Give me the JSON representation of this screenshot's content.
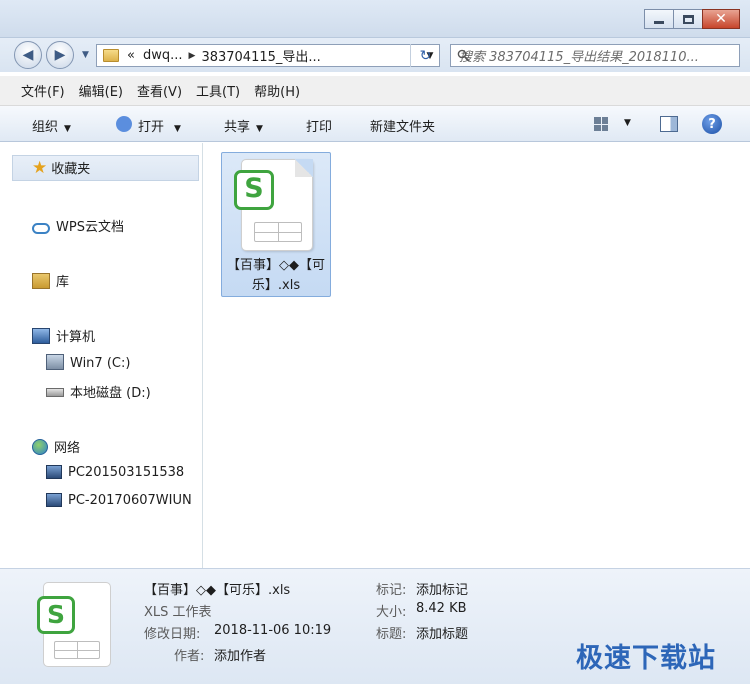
{
  "address": {
    "crumb_prefix": "«",
    "crumbs": [
      "dwq...",
      "383704115_导出..."
    ],
    "search_placeholder": "搜索 383704115_导出结果_2018110..."
  },
  "menu": [
    "文件(F)",
    "编辑(E)",
    "查看(V)",
    "工具(T)",
    "帮助(H)"
  ],
  "toolbar": {
    "organize": "组织",
    "open": "打开",
    "share": "共享",
    "print": "打印",
    "new_folder": "新建文件夹"
  },
  "nav": {
    "favorites": "收藏夹",
    "wps_cloud": "WPS云文档",
    "library": "库",
    "computer": "计算机",
    "drive_c": "Win7 (C:)",
    "drive_d": "本地磁盘 (D:)",
    "network": "网络",
    "pc1": "PC201503151538",
    "pc2": "PC-20170607WIUN"
  },
  "file": {
    "name": "【百事】◇◆【可乐】.xls",
    "icon_letter": "S",
    "type": "XLS 工作表",
    "modified_label": "修改日期:",
    "modified": "2018-11-06 10:19",
    "author_label": "作者:",
    "author": "添加作者",
    "tags_label": "标记:",
    "tags": "添加标记",
    "size_label": "大小:",
    "size": "8.42 KB",
    "title_label": "标题:",
    "title": "添加标题"
  },
  "watermark": "极速下载站",
  "colors": {
    "accent": "#2d66b8",
    "wps_green": "#3fa43f",
    "selection": "#c5daf3"
  }
}
